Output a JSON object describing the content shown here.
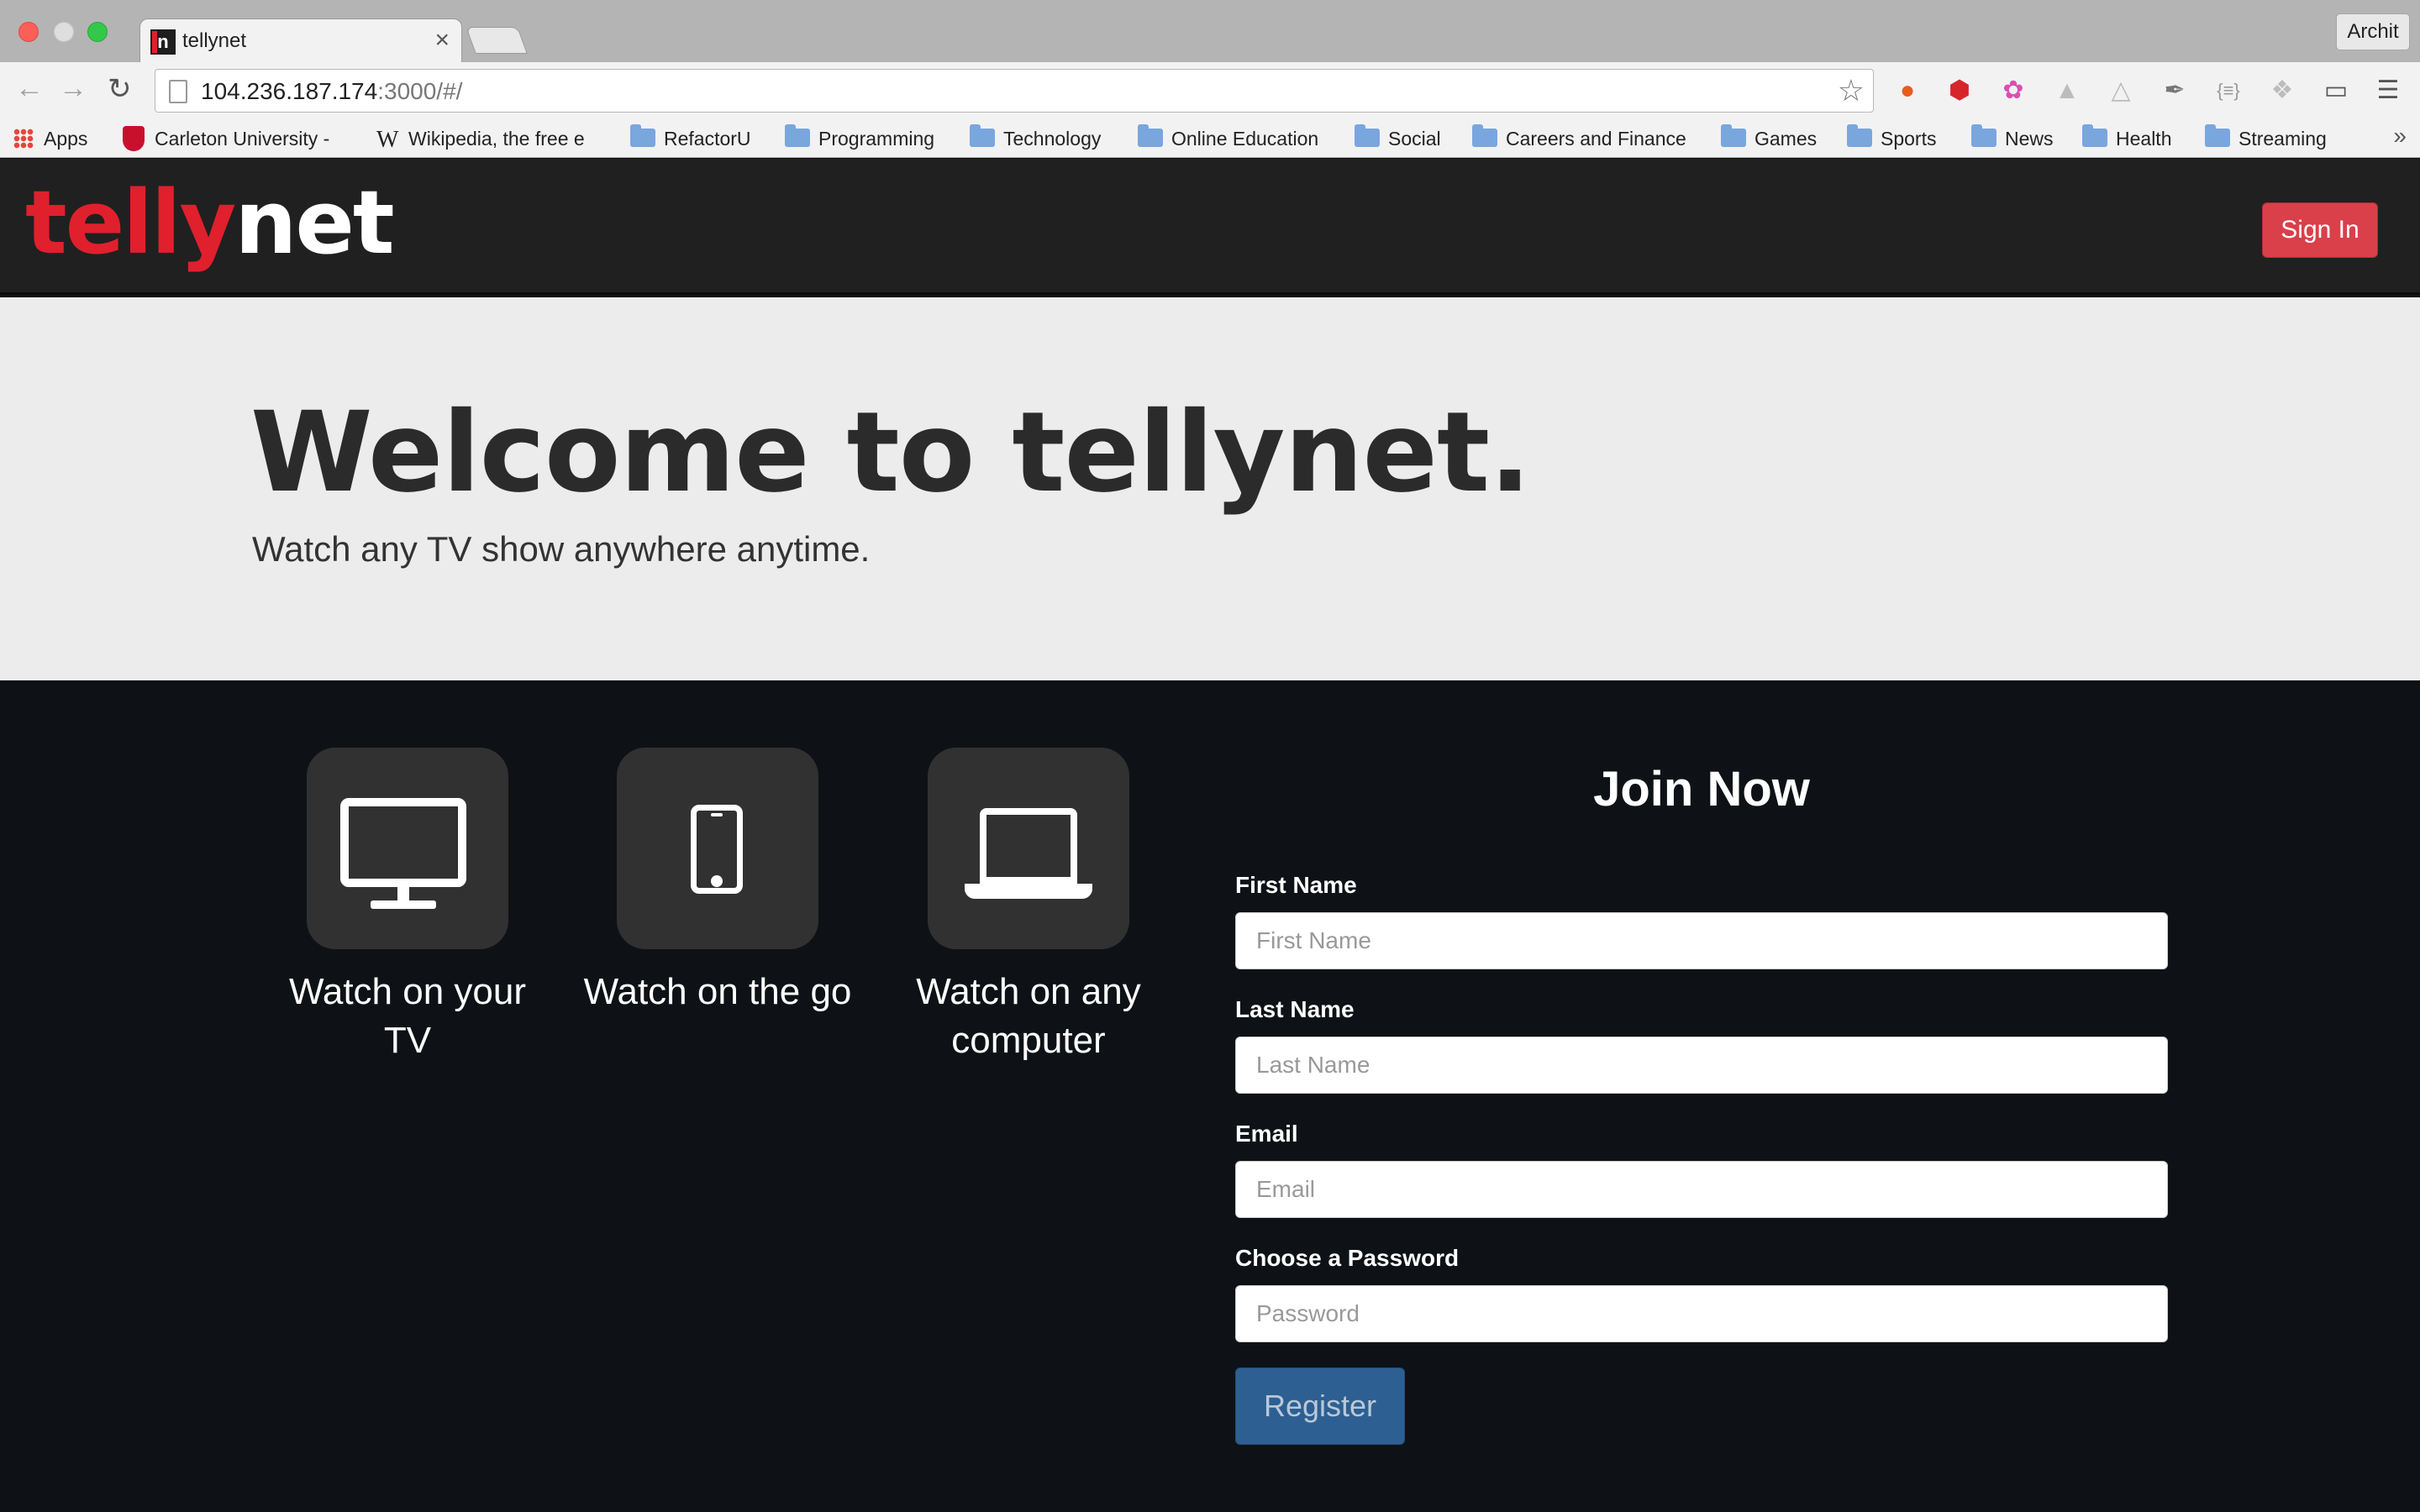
{
  "browser": {
    "tab_title": "tellynet",
    "tab_close": "×",
    "favicon_letter": "n",
    "profile_name": "Archit",
    "url_host": "104.236.187.174",
    "url_rest": ":3000/#/",
    "bookmarks": [
      {
        "label": "Apps",
        "icon": "apps-grid-icon"
      },
      {
        "label": "Carleton University -",
        "icon": "carleton-shield-icon"
      },
      {
        "label": "Wikipedia, the free e",
        "icon": "wikipedia-icon"
      },
      {
        "label": "RefactorU",
        "icon": "folder-icon"
      },
      {
        "label": "Programming",
        "icon": "folder-icon"
      },
      {
        "label": "Technology",
        "icon": "folder-icon"
      },
      {
        "label": "Online Education",
        "icon": "folder-icon"
      },
      {
        "label": "Social",
        "icon": "folder-icon"
      },
      {
        "label": "Careers and Finance",
        "icon": "folder-icon"
      },
      {
        "label": "Games",
        "icon": "folder-icon"
      },
      {
        "label": "Sports",
        "icon": "folder-icon"
      },
      {
        "label": "News",
        "icon": "folder-icon"
      },
      {
        "label": "Health",
        "icon": "folder-icon"
      },
      {
        "label": "Streaming",
        "icon": "folder-icon"
      }
    ],
    "more_bookmarks": "»"
  },
  "header": {
    "logo_part1": "telly",
    "logo_part2": "net",
    "signin_label": "Sign In",
    "logo_color_red": "#e0202c"
  },
  "hero": {
    "title": "Welcome to tellynet.",
    "subtitle": "Watch any TV show anywhere anytime."
  },
  "features": [
    {
      "label": "Watch on your TV",
      "icon": "tv-icon"
    },
    {
      "label": "Watch on the go",
      "icon": "phone-icon"
    },
    {
      "label": "Watch on any computer",
      "icon": "laptop-icon"
    }
  ],
  "join": {
    "title": "Join Now",
    "first_name_label": "First Name",
    "first_name_placeholder": "First Name",
    "last_name_label": "Last Name",
    "last_name_placeholder": "Last Name",
    "email_label": "Email",
    "email_placeholder": "Email",
    "password_label": "Choose a Password",
    "password_placeholder": "Password",
    "register_label": "Register",
    "register_color": "#2d5f92"
  }
}
